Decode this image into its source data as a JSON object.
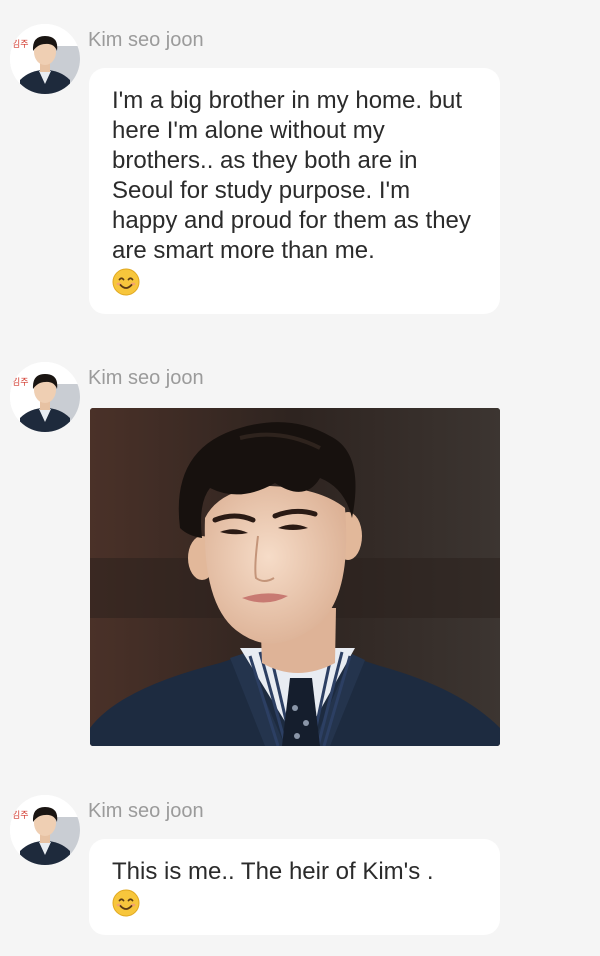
{
  "messages": [
    {
      "sender": "Kim seo joon",
      "text": "I'm a big brother in my home. but here I'm alone without my brothers.. as they both are in Seoul for study purpose.  I'm happy and proud for them as they are smart more than me.",
      "emoji": "smiling-face-emoji"
    },
    {
      "sender": "Kim seo joon",
      "image": "photo of young man in navy suit with striped shirt and tie"
    },
    {
      "sender": "Kim seo joon",
      "text": "This is me.. The heir of Kim's .",
      "emoji": "smiling-face-emoji"
    }
  ],
  "avatar": {
    "badge_text": "김주"
  },
  "colors": {
    "background": "#f5f5f5",
    "bubble": "#ffffff",
    "sender": "#9b9b9b",
    "text": "#2b2b2b",
    "emoji": "#f7c63c"
  }
}
